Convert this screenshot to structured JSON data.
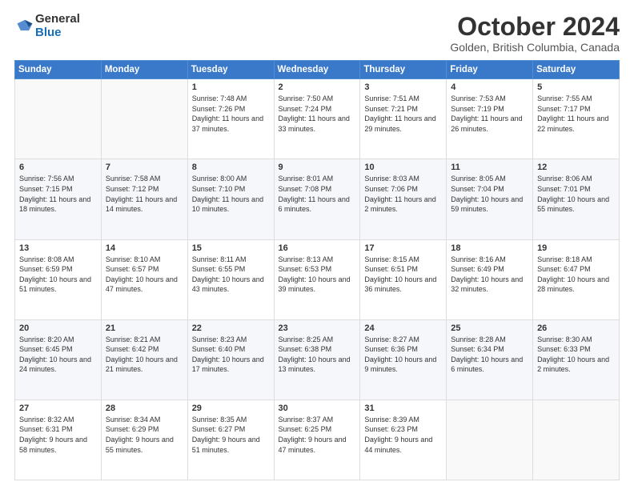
{
  "logo": {
    "general": "General",
    "blue": "Blue"
  },
  "title": {
    "month_year": "October 2024",
    "location": "Golden, British Columbia, Canada"
  },
  "weekdays": [
    "Sunday",
    "Monday",
    "Tuesday",
    "Wednesday",
    "Thursday",
    "Friday",
    "Saturday"
  ],
  "weeks": [
    [
      {
        "day": "",
        "sunrise": "",
        "sunset": "",
        "daylight": ""
      },
      {
        "day": "",
        "sunrise": "",
        "sunset": "",
        "daylight": ""
      },
      {
        "day": "1",
        "sunrise": "Sunrise: 7:48 AM",
        "sunset": "Sunset: 7:26 PM",
        "daylight": "Daylight: 11 hours and 37 minutes."
      },
      {
        "day": "2",
        "sunrise": "Sunrise: 7:50 AM",
        "sunset": "Sunset: 7:24 PM",
        "daylight": "Daylight: 11 hours and 33 minutes."
      },
      {
        "day": "3",
        "sunrise": "Sunrise: 7:51 AM",
        "sunset": "Sunset: 7:21 PM",
        "daylight": "Daylight: 11 hours and 29 minutes."
      },
      {
        "day": "4",
        "sunrise": "Sunrise: 7:53 AM",
        "sunset": "Sunset: 7:19 PM",
        "daylight": "Daylight: 11 hours and 26 minutes."
      },
      {
        "day": "5",
        "sunrise": "Sunrise: 7:55 AM",
        "sunset": "Sunset: 7:17 PM",
        "daylight": "Daylight: 11 hours and 22 minutes."
      }
    ],
    [
      {
        "day": "6",
        "sunrise": "Sunrise: 7:56 AM",
        "sunset": "Sunset: 7:15 PM",
        "daylight": "Daylight: 11 hours and 18 minutes."
      },
      {
        "day": "7",
        "sunrise": "Sunrise: 7:58 AM",
        "sunset": "Sunset: 7:12 PM",
        "daylight": "Daylight: 11 hours and 14 minutes."
      },
      {
        "day": "8",
        "sunrise": "Sunrise: 8:00 AM",
        "sunset": "Sunset: 7:10 PM",
        "daylight": "Daylight: 11 hours and 10 minutes."
      },
      {
        "day": "9",
        "sunrise": "Sunrise: 8:01 AM",
        "sunset": "Sunset: 7:08 PM",
        "daylight": "Daylight: 11 hours and 6 minutes."
      },
      {
        "day": "10",
        "sunrise": "Sunrise: 8:03 AM",
        "sunset": "Sunset: 7:06 PM",
        "daylight": "Daylight: 11 hours and 2 minutes."
      },
      {
        "day": "11",
        "sunrise": "Sunrise: 8:05 AM",
        "sunset": "Sunset: 7:04 PM",
        "daylight": "Daylight: 10 hours and 59 minutes."
      },
      {
        "day": "12",
        "sunrise": "Sunrise: 8:06 AM",
        "sunset": "Sunset: 7:01 PM",
        "daylight": "Daylight: 10 hours and 55 minutes."
      }
    ],
    [
      {
        "day": "13",
        "sunrise": "Sunrise: 8:08 AM",
        "sunset": "Sunset: 6:59 PM",
        "daylight": "Daylight: 10 hours and 51 minutes."
      },
      {
        "day": "14",
        "sunrise": "Sunrise: 8:10 AM",
        "sunset": "Sunset: 6:57 PM",
        "daylight": "Daylight: 10 hours and 47 minutes."
      },
      {
        "day": "15",
        "sunrise": "Sunrise: 8:11 AM",
        "sunset": "Sunset: 6:55 PM",
        "daylight": "Daylight: 10 hours and 43 minutes."
      },
      {
        "day": "16",
        "sunrise": "Sunrise: 8:13 AM",
        "sunset": "Sunset: 6:53 PM",
        "daylight": "Daylight: 10 hours and 39 minutes."
      },
      {
        "day": "17",
        "sunrise": "Sunrise: 8:15 AM",
        "sunset": "Sunset: 6:51 PM",
        "daylight": "Daylight: 10 hours and 36 minutes."
      },
      {
        "day": "18",
        "sunrise": "Sunrise: 8:16 AM",
        "sunset": "Sunset: 6:49 PM",
        "daylight": "Daylight: 10 hours and 32 minutes."
      },
      {
        "day": "19",
        "sunrise": "Sunrise: 8:18 AM",
        "sunset": "Sunset: 6:47 PM",
        "daylight": "Daylight: 10 hours and 28 minutes."
      }
    ],
    [
      {
        "day": "20",
        "sunrise": "Sunrise: 8:20 AM",
        "sunset": "Sunset: 6:45 PM",
        "daylight": "Daylight: 10 hours and 24 minutes."
      },
      {
        "day": "21",
        "sunrise": "Sunrise: 8:21 AM",
        "sunset": "Sunset: 6:42 PM",
        "daylight": "Daylight: 10 hours and 21 minutes."
      },
      {
        "day": "22",
        "sunrise": "Sunrise: 8:23 AM",
        "sunset": "Sunset: 6:40 PM",
        "daylight": "Daylight: 10 hours and 17 minutes."
      },
      {
        "day": "23",
        "sunrise": "Sunrise: 8:25 AM",
        "sunset": "Sunset: 6:38 PM",
        "daylight": "Daylight: 10 hours and 13 minutes."
      },
      {
        "day": "24",
        "sunrise": "Sunrise: 8:27 AM",
        "sunset": "Sunset: 6:36 PM",
        "daylight": "Daylight: 10 hours and 9 minutes."
      },
      {
        "day": "25",
        "sunrise": "Sunrise: 8:28 AM",
        "sunset": "Sunset: 6:34 PM",
        "daylight": "Daylight: 10 hours and 6 minutes."
      },
      {
        "day": "26",
        "sunrise": "Sunrise: 8:30 AM",
        "sunset": "Sunset: 6:33 PM",
        "daylight": "Daylight: 10 hours and 2 minutes."
      }
    ],
    [
      {
        "day": "27",
        "sunrise": "Sunrise: 8:32 AM",
        "sunset": "Sunset: 6:31 PM",
        "daylight": "Daylight: 9 hours and 58 minutes."
      },
      {
        "day": "28",
        "sunrise": "Sunrise: 8:34 AM",
        "sunset": "Sunset: 6:29 PM",
        "daylight": "Daylight: 9 hours and 55 minutes."
      },
      {
        "day": "29",
        "sunrise": "Sunrise: 8:35 AM",
        "sunset": "Sunset: 6:27 PM",
        "daylight": "Daylight: 9 hours and 51 minutes."
      },
      {
        "day": "30",
        "sunrise": "Sunrise: 8:37 AM",
        "sunset": "Sunset: 6:25 PM",
        "daylight": "Daylight: 9 hours and 47 minutes."
      },
      {
        "day": "31",
        "sunrise": "Sunrise: 8:39 AM",
        "sunset": "Sunset: 6:23 PM",
        "daylight": "Daylight: 9 hours and 44 minutes."
      },
      {
        "day": "",
        "sunrise": "",
        "sunset": "",
        "daylight": ""
      },
      {
        "day": "",
        "sunrise": "",
        "sunset": "",
        "daylight": ""
      }
    ]
  ]
}
